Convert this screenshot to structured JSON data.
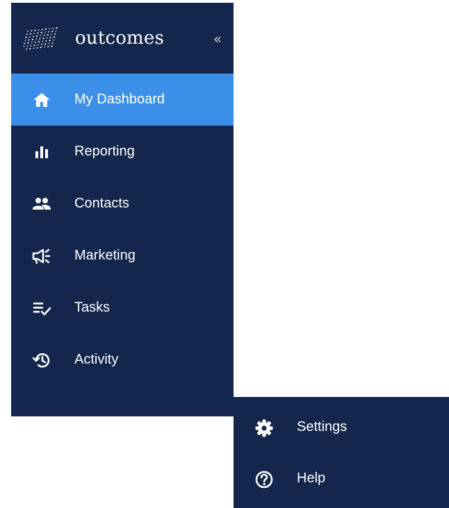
{
  "brand": {
    "name": "outcomes",
    "logo_icon": "dot-grid-logo-icon",
    "collapse_icon": "double-chevron-left-icon",
    "collapse_glyph": "«"
  },
  "nav": {
    "items": [
      {
        "label": "My Dashboard",
        "icon": "home-icon",
        "active": true
      },
      {
        "label": "Reporting",
        "icon": "bar-chart-icon",
        "active": false
      },
      {
        "label": "Contacts",
        "icon": "people-icon",
        "active": false
      },
      {
        "label": "Marketing",
        "icon": "megaphone-icon",
        "active": false
      },
      {
        "label": "Tasks",
        "icon": "list-check-icon",
        "active": false
      },
      {
        "label": "Activity",
        "icon": "history-icon",
        "active": false
      }
    ]
  },
  "footer": {
    "items": [
      {
        "label": "Settings",
        "icon": "gear-icon"
      },
      {
        "label": "Help",
        "icon": "help-circle-icon"
      }
    ]
  },
  "colors": {
    "sidebar_bg": "#14264b",
    "active_bg": "#3b8fe8",
    "text": "#ffffff",
    "page_bg": "#ffffff"
  }
}
